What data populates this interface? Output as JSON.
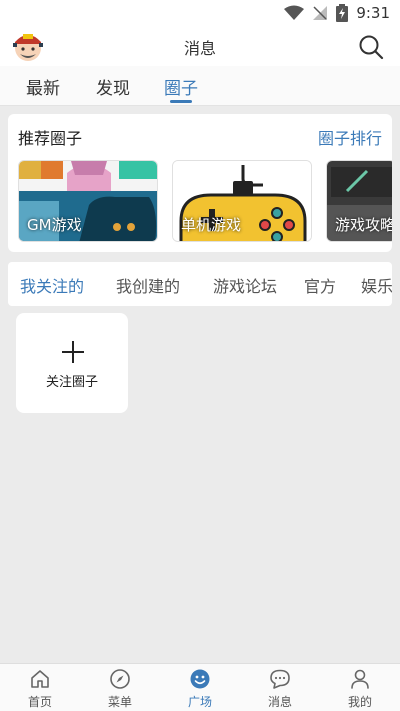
{
  "status_bar": {
    "time": "9:31"
  },
  "header": {
    "title": "消息"
  },
  "top_tabs": [
    {
      "label": "最新",
      "active": false
    },
    {
      "label": "发现",
      "active": false
    },
    {
      "label": "圈子",
      "active": true
    }
  ],
  "recommend": {
    "title": "推荐圈子",
    "ranking_link": "圈子排行",
    "circles": [
      {
        "label": "GM游戏"
      },
      {
        "label": "单机游戏"
      },
      {
        "label": "游戏攻略"
      }
    ]
  },
  "sub_tabs": [
    {
      "label": "我关注的",
      "active": true
    },
    {
      "label": "我创建的",
      "active": false
    },
    {
      "label": "游戏论坛",
      "active": false
    },
    {
      "label": "官方",
      "active": false
    },
    {
      "label": "娱乐",
      "active": false
    }
  ],
  "follow_card": {
    "label": "关注圈子"
  },
  "bottom_nav": [
    {
      "label": "首页",
      "icon": "home-icon",
      "active": false
    },
    {
      "label": "菜单",
      "icon": "compass-icon",
      "active": false
    },
    {
      "label": "广场",
      "icon": "smile-icon",
      "active": true
    },
    {
      "label": "消息",
      "icon": "message-icon",
      "active": false
    },
    {
      "label": "我的",
      "icon": "person-icon",
      "active": false
    }
  ],
  "colors": {
    "accent": "#3b7ab8",
    "background": "#ebebeb"
  }
}
